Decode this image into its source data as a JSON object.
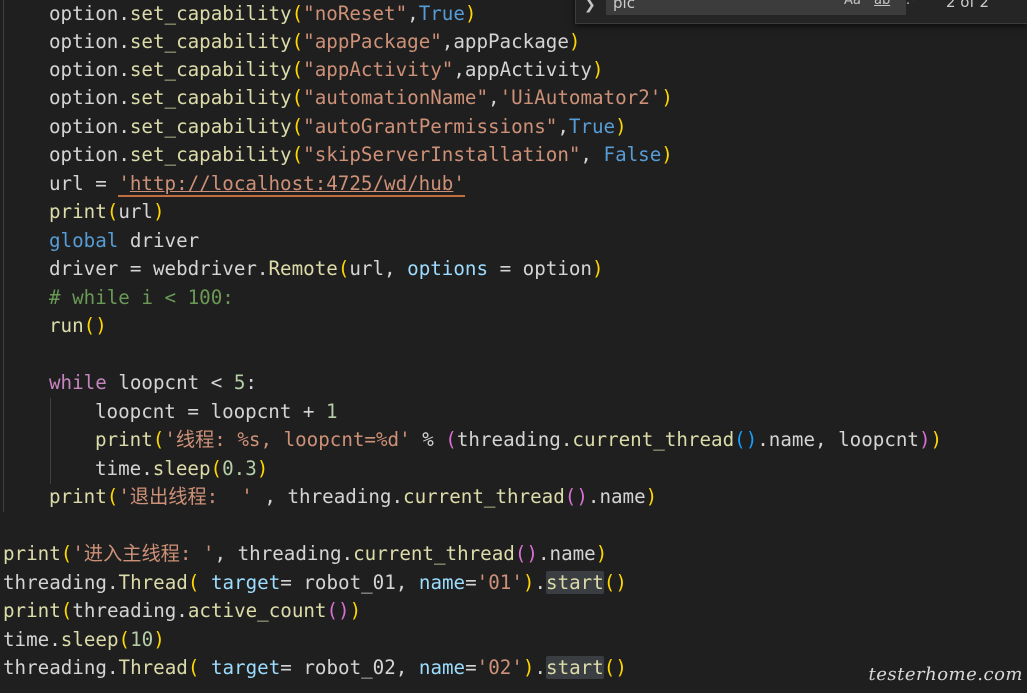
{
  "find": {
    "query": "pic",
    "match_case": "Aa",
    "whole_word": "ab",
    "regex": ".*",
    "count": "2 of 2"
  },
  "watermark": "testerhome.com",
  "code": {
    "l1": [
      "option",
      ".",
      "set_capability",
      "(",
      "\"noReset\"",
      ",",
      "True",
      ")"
    ],
    "l2": [
      "option",
      ".",
      "set_capability",
      "(",
      "\"appPackage\"",
      ",appPackage",
      ")"
    ],
    "l3": [
      "option",
      ".",
      "set_capability",
      "(",
      "\"appActivity\"",
      ",appActivity",
      ")"
    ],
    "l4": [
      "option",
      ".",
      "set_capability",
      "(",
      "\"automationName\"",
      ",",
      "'UiAutomator2'",
      ")"
    ],
    "l5": [
      "option",
      ".",
      "set_capability",
      "(",
      "\"autoGrantPermissions\"",
      ",",
      "True",
      ")"
    ],
    "l6": [
      "option",
      ".",
      "set_capability",
      "(",
      "\"skipServerInstallation\"",
      ", ",
      "False",
      ")"
    ],
    "l7": [
      "url = ",
      "'",
      "http://localhost:4725/wd/hub",
      "'"
    ],
    "l8": [
      "print",
      "(",
      "url",
      ")"
    ],
    "l9": [
      "global",
      " driver"
    ],
    "l10": [
      "driver = webdriver.",
      "Remote",
      "(",
      "url, ",
      "options",
      " = option",
      ")"
    ],
    "l11": [
      "# while i < 100:"
    ],
    "l12": [
      "run",
      "(",
      ")"
    ],
    "l13": [
      "while",
      " loopcnt < ",
      "5",
      ":"
    ],
    "l14": [
      "loopcnt = loopcnt + ",
      "1"
    ],
    "l15": [
      "print",
      "(",
      "'线程: %s, loopcnt=%d'",
      " % ",
      "(",
      "threading.",
      "current_thread",
      "(",
      ")",
      ".name, loopcnt",
      ")",
      ")"
    ],
    "l16": [
      "time.",
      "sleep",
      "(",
      "0.3",
      ")"
    ],
    "l17": [
      "print",
      "(",
      "'退出线程:  '",
      " , threading.",
      "current_thread",
      "(",
      ")",
      ".name",
      ")"
    ],
    "l18": [
      "print",
      "(",
      "'进入主线程: '",
      ", threading.",
      "current_thread",
      "(",
      ")",
      ".name",
      ")"
    ],
    "l19": [
      "threading.",
      "Thread",
      "( ",
      "target",
      "= robot_01, ",
      "name",
      "=",
      "'01'",
      ")",
      ".",
      "start",
      "(",
      ")"
    ],
    "l20": [
      "print",
      "(",
      "threading.",
      "active_count",
      "(",
      ")",
      ")"
    ],
    "l21": [
      "time.",
      "sleep",
      "(",
      "10",
      ")"
    ],
    "l22": [
      "threading.",
      "Thread",
      "( ",
      "target",
      "= robot_02, ",
      "name",
      "=",
      "'02'",
      ")",
      ".",
      "start",
      "(",
      ")"
    ]
  }
}
